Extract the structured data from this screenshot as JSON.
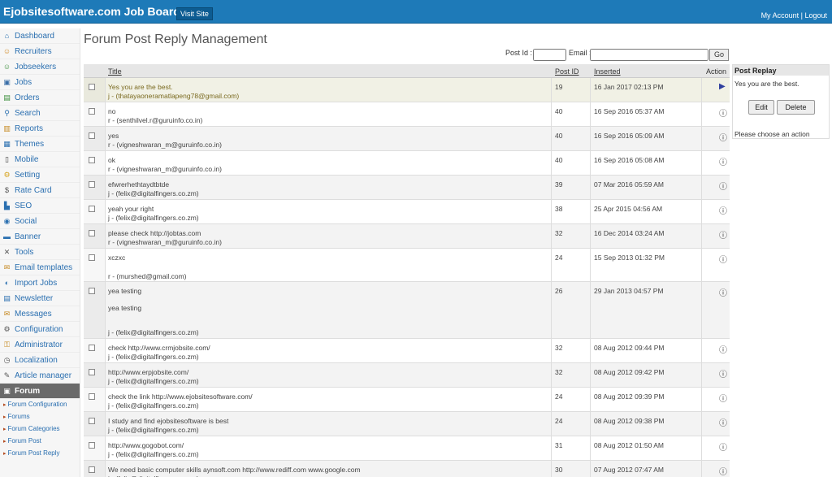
{
  "header": {
    "brand": "Ejobsitesoftware.com Job Board",
    "visit_site": "Visit Site",
    "my_account": "My Account",
    "separator": "|",
    "logout": "Logout"
  },
  "sidebar": {
    "items": [
      {
        "label": "Dashboard",
        "icon": "home-icon"
      },
      {
        "label": "Recruiters",
        "icon": "recruiter-icon"
      },
      {
        "label": "Jobseekers",
        "icon": "jobseekers-icon"
      },
      {
        "label": "Jobs",
        "icon": "jobs-icon"
      },
      {
        "label": "Orders",
        "icon": "orders-icon"
      },
      {
        "label": "Search",
        "icon": "search-icon"
      },
      {
        "label": "Reports",
        "icon": "reports-icon"
      },
      {
        "label": "Themes",
        "icon": "themes-icon"
      },
      {
        "label": "Mobile",
        "icon": "mobile-icon"
      },
      {
        "label": "Setting",
        "icon": "setting-icon"
      },
      {
        "label": "Rate Card",
        "icon": "rate-card-icon"
      },
      {
        "label": "SEO",
        "icon": "seo-icon"
      },
      {
        "label": "Social",
        "icon": "social-icon"
      },
      {
        "label": "Banner",
        "icon": "banner-icon"
      },
      {
        "label": "Tools",
        "icon": "tools-icon"
      },
      {
        "label": "Email templates",
        "icon": "email-icon"
      },
      {
        "label": "Import Jobs",
        "icon": "import-icon"
      },
      {
        "label": "Newsletter",
        "icon": "newsletter-icon"
      },
      {
        "label": "Messages",
        "icon": "messages-icon"
      },
      {
        "label": "Configuration",
        "icon": "configuration-icon"
      },
      {
        "label": "Administrator",
        "icon": "administrator-icon"
      },
      {
        "label": "Localization",
        "icon": "localization-icon"
      },
      {
        "label": "Article manager",
        "icon": "article-icon"
      },
      {
        "label": "Forum",
        "icon": "forum-icon"
      }
    ],
    "sub_items": [
      {
        "label": "Forum Configuration"
      },
      {
        "label": "Forums"
      },
      {
        "label": "Forum Categories"
      },
      {
        "label": "Forum Post"
      },
      {
        "label": "Forum Post Reply"
      }
    ]
  },
  "main": {
    "title": "Forum Post Reply Management",
    "post_id_label": "Post Id :",
    "email_label": "Email :",
    "go_label": "Go",
    "columns": {
      "title": "Title",
      "post_id": "Post ID",
      "inserted": "Inserted",
      "action": "Action"
    },
    "rows": [
      {
        "title": "Yes you are the best.",
        "author": "j - (thatayaoneramatlapeng78@gmail.com)",
        "post_id": "19",
        "inserted": "16 Jan 2017 02:13 PM"
      },
      {
        "title": "no",
        "author": "r - (senthilvel.r@guruinfo.co.in)",
        "post_id": "40",
        "inserted": "16 Sep 2016 05:37 AM"
      },
      {
        "title": "yes",
        "author": "r - (vigneshwaran_m@guruinfo.co.in)",
        "post_id": "40",
        "inserted": "16 Sep 2016 05:09 AM"
      },
      {
        "title": "ok",
        "author": "r - (vigneshwaran_m@guruinfo.co.in)",
        "post_id": "40",
        "inserted": "16 Sep 2016 05:08 AM"
      },
      {
        "title": "efwrerhethtaydtbtde",
        "author": "j - (felix@digitalfingers.co.zm)",
        "post_id": "39",
        "inserted": "07 Mar 2016 05:59 AM"
      },
      {
        "title": "yeah your right",
        "author": "j - (felix@digitalfingers.co.zm)",
        "post_id": "38",
        "inserted": "25 Apr 2015 04:56 AM"
      },
      {
        "title": "please check http://jobtas.com",
        "author": "r - (vigneshwaran_m@guruinfo.co.in)",
        "post_id": "32",
        "inserted": "16 Dec 2014 03:24 AM"
      },
      {
        "title": "xczxc",
        "author": "r - (murshed@gmail.com)",
        "post_id": "24",
        "inserted": "15 Sep 2013 01:32 PM"
      },
      {
        "title": "yea testing",
        "title2": "yea testing",
        "author": "j - (felix@digitalfingers.co.zm)",
        "post_id": "26",
        "inserted": "29 Jan 2013 04:57 PM"
      },
      {
        "title": "check http://www.crmjobsite.com/",
        "author": "j - (felix@digitalfingers.co.zm)",
        "post_id": "32",
        "inserted": "08 Aug 2012 09:44 PM"
      },
      {
        "title": "http://www.erpjobsite.com/",
        "author": "j - (felix@digitalfingers.co.zm)",
        "post_id": "32",
        "inserted": "08 Aug 2012 09:42 PM"
      },
      {
        "title": "check the link http://www.ejobsitesoftware.com/",
        "author": "j - (felix@digitalfingers.co.zm)",
        "post_id": "24",
        "inserted": "08 Aug 2012 09:39 PM"
      },
      {
        "title": "I study and find ejobsitesoftware is best",
        "author": "j - (felix@digitalfingers.co.zm)",
        "post_id": "24",
        "inserted": "08 Aug 2012 09:38 PM"
      },
      {
        "title": "http://www.gogobot.com/",
        "author": "j - (felix@digitalfingers.co.zm)",
        "post_id": "31",
        "inserted": "08 Aug 2012 01:50 AM"
      },
      {
        "title": "We need basic computer skills aynsoft.com http://www.rediff.com www.google.com",
        "author": "j - (felix@digitalfingers.co.zm)",
        "post_id": "30",
        "inserted": "07 Aug 2012 07:47 AM"
      }
    ]
  },
  "panel": {
    "title": "Post Replay",
    "content": "Yes you are the best.",
    "edit_label": "Edit",
    "delete_label": "Delete",
    "message": "Please choose an action"
  },
  "colors": {
    "topbar": "#1e7ab8",
    "link": "#2a6fb0",
    "active_nav": "#6a6a6a"
  }
}
